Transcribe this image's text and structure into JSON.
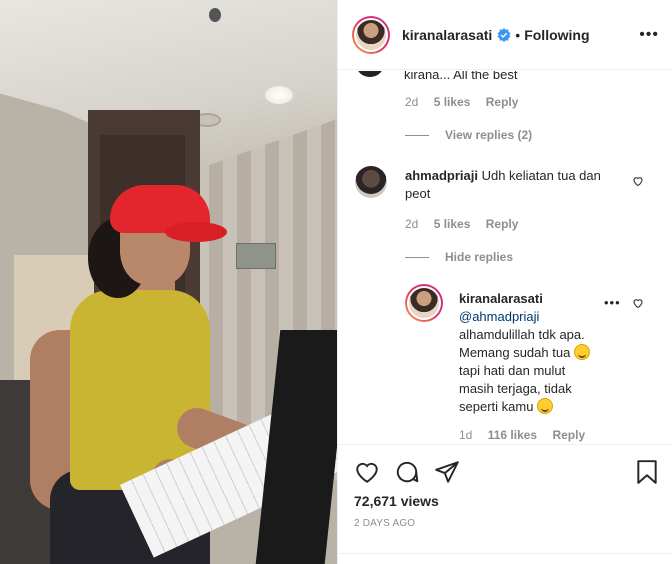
{
  "header": {
    "username": "kiranalarasati",
    "separator": "•",
    "follow_status": "Following",
    "more_label": "•••"
  },
  "comments": {
    "partial": {
      "text": "kirana... All the best",
      "time": "2d",
      "likes": "5 likes",
      "reply_label": "Reply",
      "view_replies": "View replies (2)"
    },
    "main": {
      "username": "ahmadpriaji",
      "text_line1": "Udh keliatan tua dan",
      "text_line2": "peot",
      "time": "2d",
      "likes": "5 likes",
      "reply_label": "Reply",
      "hide_replies": "Hide replies"
    },
    "reply": {
      "username": "kiranalarasati",
      "mention": "@ahmadpriaji",
      "line1": "alhamdulillah tdk apa.",
      "line2": "Memang sudah tua",
      "line3": "tapi hati dan mulut",
      "line4": "masih terjaga, tidak",
      "line5": "seperti kamu",
      "time": "1d",
      "likes": "116 likes",
      "reply_label": "Reply",
      "more_label": "•••"
    }
  },
  "actions": {
    "icons": [
      "heart-icon",
      "comment-icon",
      "share-icon",
      "bookmark-icon"
    ],
    "views": "72,671 views",
    "date": "2 DAYS AGO"
  },
  "colors": {
    "verified": "#3897f0",
    "link": "#00376b",
    "muted": "#8e8e8e",
    "text": "#262626"
  }
}
